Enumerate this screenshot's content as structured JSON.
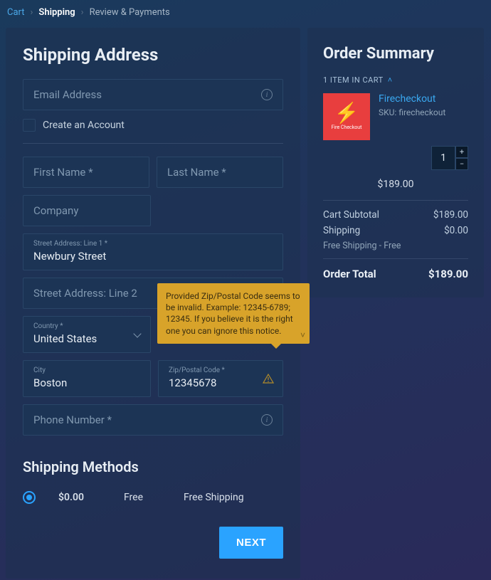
{
  "breadcrumb": {
    "cart": "Cart",
    "shipping": "Shipping",
    "review": "Review & Payments"
  },
  "heading": "Shipping Address",
  "email": {
    "placeholder": "Email Address",
    "create_account": "Create an Account"
  },
  "name": {
    "first_ph": "First Name *",
    "last_ph": "Last Name *"
  },
  "company_ph": "Company",
  "street": {
    "line1_label": "Street Address: Line 1  *",
    "line1_value": "Newbury Street",
    "line2_ph": "Street Address: Line 2"
  },
  "country": {
    "label": "Country  *",
    "value": "United States"
  },
  "city": {
    "label": "City",
    "value": "Boston"
  },
  "zip": {
    "label": "Zip/Postal Code  *",
    "value": "12345678",
    "tooltip": "Provided Zip/Postal Code seems to be invalid. Example: 12345-6789; 12345. If you believe it is the right one you can ignore this notice."
  },
  "phone_ph": "Phone Number *",
  "methods_heading": "Shipping Methods",
  "method": {
    "price": "$0.00",
    "type": "Free",
    "name": "Free Shipping"
  },
  "next_label": "NEXT",
  "summary": {
    "heading": "Order Summary",
    "count_text": "1 ITEM IN CART",
    "item": {
      "name": "Firecheckout",
      "sku_line": "SKU: firecheckout",
      "qty": "1",
      "price": "$189.00",
      "thumb_label": "Fire Checkout"
    },
    "subtotal_label": "Cart Subtotal",
    "subtotal_value": "$189.00",
    "shipping_label": "Shipping",
    "shipping_value": "$0.00",
    "shipping_sub": "Free Shipping - Free",
    "total_label": "Order Total",
    "total_value": "$189.00"
  }
}
